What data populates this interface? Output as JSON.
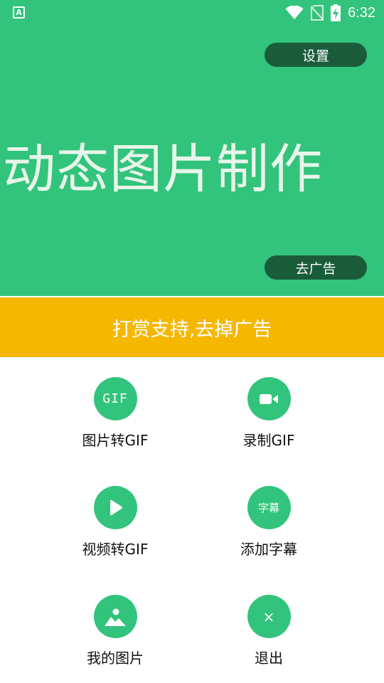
{
  "status_bar": {
    "left_icon_glyph": "A",
    "time": "6:32",
    "icons": [
      "wifi-icon",
      "no-sim-icon",
      "battery-charging-icon"
    ]
  },
  "hero": {
    "title": "动态图片制作",
    "settings_label": "设置",
    "remove_ad_label": "去广告",
    "bg_color": "#32c47c",
    "button_color": "#1a5c3a"
  },
  "donate": {
    "label": "打赏支持,去掉广告",
    "bg_color": "#f5b700"
  },
  "menu": {
    "items": [
      {
        "label": "图片转GIF",
        "icon": "gif-icon",
        "icon_text": "GIF"
      },
      {
        "label": "录制GIF",
        "icon": "video-camera-icon"
      },
      {
        "label": "视频转GIF",
        "icon": "play-icon"
      },
      {
        "label": "添加字幕",
        "icon": "subtitle-icon",
        "icon_text": "字幕"
      },
      {
        "label": "我的图片",
        "icon": "image-icon"
      },
      {
        "label": "退出",
        "icon": "close-icon",
        "icon_text": "×"
      }
    ]
  }
}
